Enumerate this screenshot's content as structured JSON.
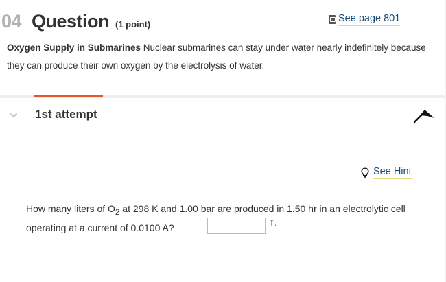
{
  "question": {
    "number": "04",
    "title": "Question",
    "points": "(1 point)"
  },
  "see_page": {
    "icon": "book-icon",
    "label": "See page 801"
  },
  "intro": {
    "bold": "Oxygen Supply in Submarines",
    "text": " Nuclear submarines can stay under water nearly indefinitely because they can produce their own oxygen by the electrolysis of water."
  },
  "attempt": {
    "label": "1st attempt"
  },
  "hint": {
    "icon": "lightbulb-icon",
    "label": "See Hint"
  },
  "prompt": {
    "part1": "How many liters of O",
    "sub": "2",
    "part2": " at 298 K and 1.00 bar are produced in 1.50 hr in an electrolytic cell operating at a current of 0.0100 A?"
  },
  "answer": {
    "value": "",
    "unit": "L"
  },
  "colors": {
    "accent_orange": "#e2552d",
    "link_blue": "#1a4c7a",
    "link_underline": "#e6dd7a",
    "number_gray": "#b0b0b0"
  }
}
